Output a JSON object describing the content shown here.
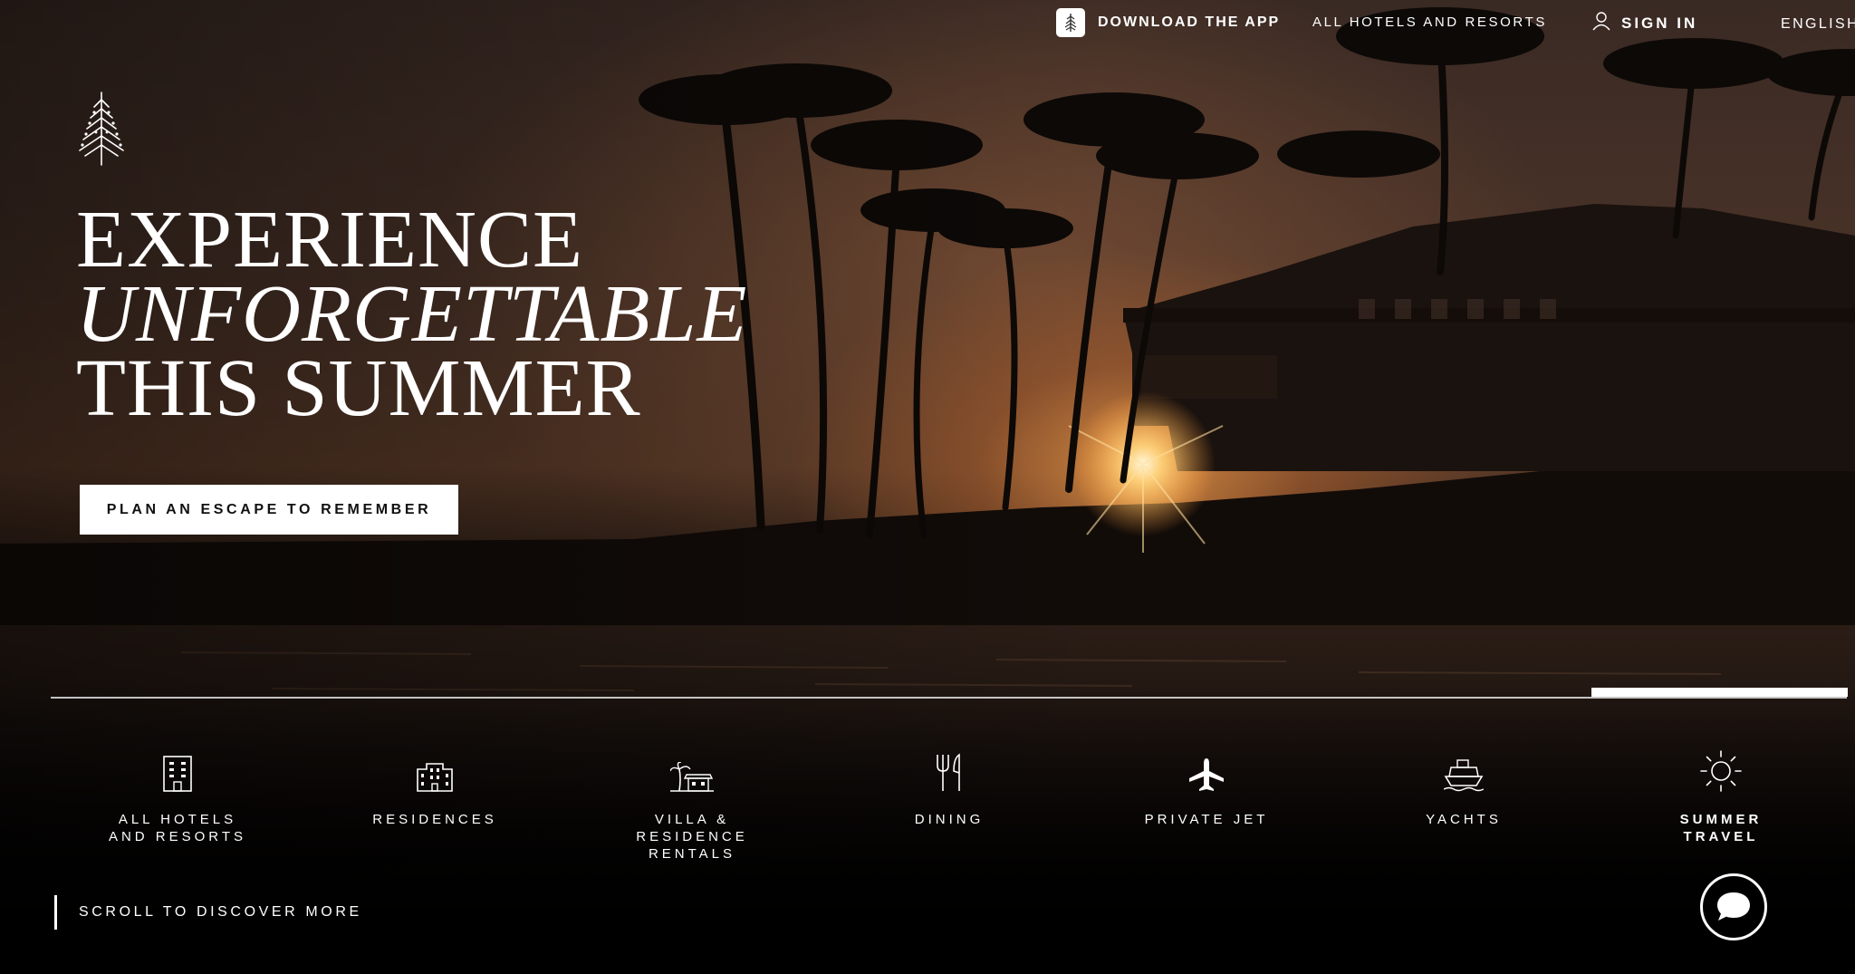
{
  "topnav": {
    "download_app": "DOWNLOAD THE APP",
    "all_hotels": "ALL HOTELS AND RESORTS",
    "sign_in": "SIGN IN",
    "language": "ENGLISH"
  },
  "hero": {
    "headline_line1": "EXPERIENCE",
    "headline_line2": "UNFORGETTABLE",
    "headline_line3": "THIS SUMMER",
    "cta_label": "PLAN AN ESCAPE TO REMEMBER",
    "slide_progress": 0.857
  },
  "categories": [
    {
      "label": "ALL HOTELS\nAND RESORTS",
      "icon": "hotel-building-icon"
    },
    {
      "label": "RESIDENCES",
      "icon": "residence-building-icon"
    },
    {
      "label": "VILLA &\nRESIDENCE\nRENTALS",
      "icon": "villa-palm-icon"
    },
    {
      "label": "DINING",
      "icon": "fork-knife-icon"
    },
    {
      "label": "PRIVATE JET",
      "icon": "airplane-icon"
    },
    {
      "label": "YACHTS",
      "icon": "yacht-icon"
    },
    {
      "label": "SUMMER\nTRAVEL",
      "icon": "sun-icon",
      "active": true
    }
  ],
  "footer": {
    "scroll_hint": "SCROLL TO DISCOVER MORE",
    "chat_icon": "chat-bubble-icon"
  },
  "colors": {
    "accent": "#ffffff",
    "sunset": "#e8a050",
    "background": "#000000"
  }
}
